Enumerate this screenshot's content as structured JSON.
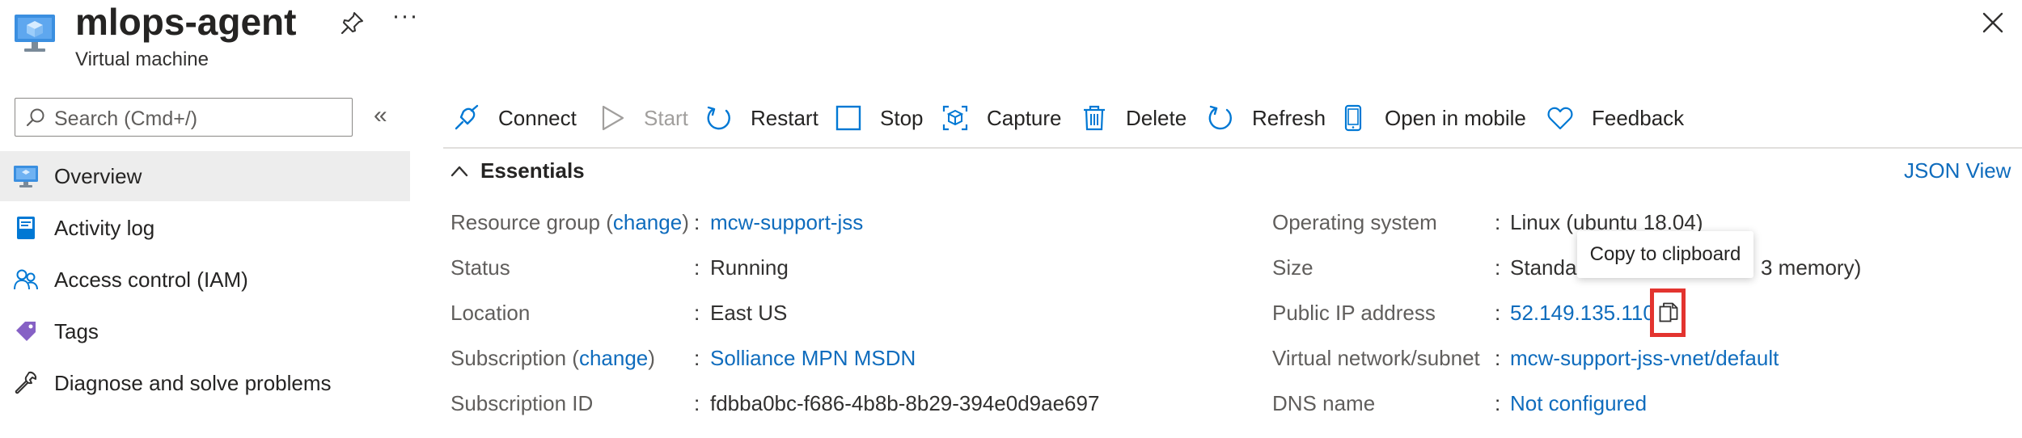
{
  "header": {
    "title": "mlops-agent",
    "subtitle": "Virtual machine",
    "more_label": "···"
  },
  "search": {
    "placeholder": "Search (Cmd+/)",
    "collapse_label": "«"
  },
  "sidebar": {
    "items": [
      {
        "label": "Overview",
        "icon": "monitor-icon",
        "selected": true
      },
      {
        "label": "Activity log",
        "icon": "activity-log-icon",
        "selected": false
      },
      {
        "label": "Access control (IAM)",
        "icon": "people-icon",
        "selected": false
      },
      {
        "label": "Tags",
        "icon": "tag-icon",
        "selected": false
      },
      {
        "label": "Diagnose and solve problems",
        "icon": "wrench-icon",
        "selected": false
      }
    ]
  },
  "toolbar": {
    "connect": "Connect",
    "start": "Start",
    "restart": "Restart",
    "stop": "Stop",
    "capture": "Capture",
    "delete": "Delete",
    "refresh": "Refresh",
    "open_in_mobile": "Open in mobile",
    "feedback": "Feedback"
  },
  "essentials": {
    "title": "Essentials",
    "json_view": "JSON View",
    "left": {
      "resource_group": {
        "label_prefix": "Resource group (",
        "change": "change",
        "label_suffix": ")",
        "value": "mcw-support-jss"
      },
      "status": {
        "label": "Status",
        "value": "Running"
      },
      "location": {
        "label": "Location",
        "value": "East US"
      },
      "subscription": {
        "label_prefix": "Subscription (",
        "change": "change",
        "label_suffix": ")",
        "value": "Solliance MPN MSDN"
      },
      "subscription_id": {
        "label": "Subscription ID",
        "value": "fdbba0bc-f686-4b8b-8b29-394e0d9ae697"
      }
    },
    "right": {
      "operating_system": {
        "label": "Operating system",
        "value": "Linux (ubuntu 18.04)"
      },
      "size": {
        "label": "Size",
        "value_start": "Standar",
        "value_end": "3 memory)"
      },
      "public_ip": {
        "label": "Public IP address",
        "value": "52.149.135.110"
      },
      "vnet": {
        "label": "Virtual network/subnet",
        "value": "mcw-support-jss-vnet/default"
      },
      "dns": {
        "label": "DNS name",
        "value": "Not configured"
      }
    },
    "colon": ":"
  },
  "tooltip": {
    "text": "Copy to clipboard"
  },
  "colors": {
    "link": "#0f6cbd",
    "highlight": "#e3342f",
    "azure_blue": "#0078d4"
  }
}
